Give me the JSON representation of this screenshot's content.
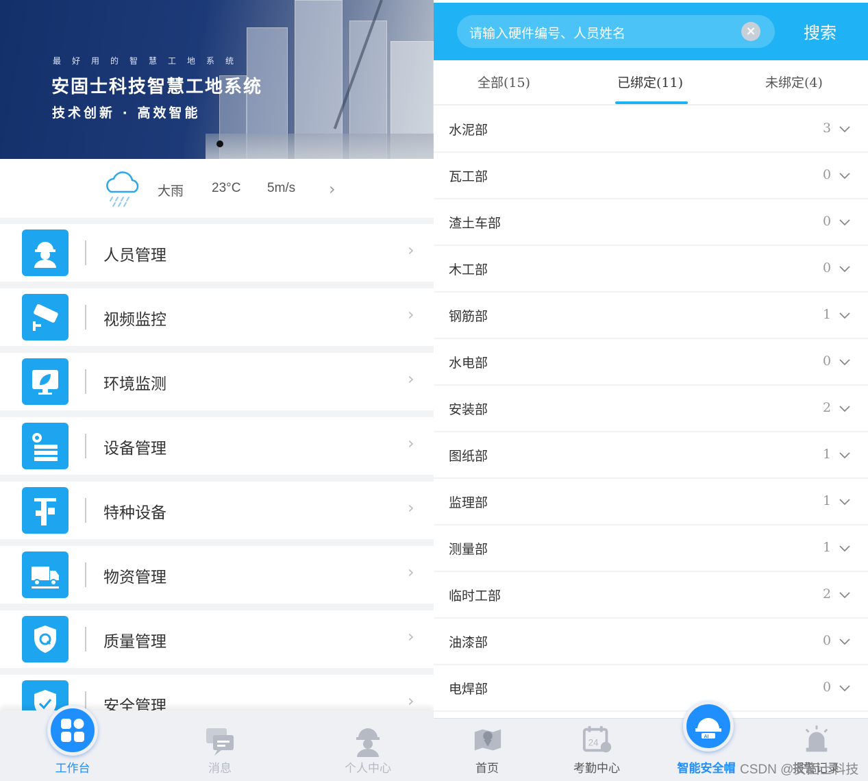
{
  "left": {
    "banner": {
      "tagline": "最好用的智慧工地系统",
      "title": "安固士科技智慧工地系统",
      "subtitle": "技术创新 · 高效智能"
    },
    "weather": {
      "icon": "rain-cloud-icon",
      "condition": "大雨",
      "temperature": "23°C",
      "wind": "5m/s"
    },
    "menu": [
      {
        "label": "人员管理",
        "icon": "worker-icon"
      },
      {
        "label": "视频监控",
        "icon": "camera-icon"
      },
      {
        "label": "环境监测",
        "icon": "monitor-leaf-icon"
      },
      {
        "label": "设备管理",
        "icon": "gear-server-icon"
      },
      {
        "label": "特种设备",
        "icon": "tower-crane-icon"
      },
      {
        "label": "物资管理",
        "icon": "truck-icon"
      },
      {
        "label": "质量管理",
        "icon": "quality-shield-icon"
      },
      {
        "label": "安全管理",
        "icon": "safety-shield-icon"
      }
    ],
    "tabbar": [
      {
        "label": "工作台",
        "icon": "dashboard-icon",
        "active": true
      },
      {
        "label": "消息",
        "icon": "message-icon",
        "active": false
      },
      {
        "label": "个人中心",
        "icon": "user-helmet-icon",
        "active": false
      }
    ]
  },
  "right": {
    "search": {
      "placeholder": "请输入硬件编号、人员姓名",
      "button": "搜索"
    },
    "tabs": [
      {
        "label": "全部(15)",
        "active": false
      },
      {
        "label": "已绑定(11)",
        "active": true
      },
      {
        "label": "未绑定(4)",
        "active": false
      }
    ],
    "departments": [
      {
        "name": "水泥部",
        "count": "3"
      },
      {
        "name": "瓦工部",
        "count": "0"
      },
      {
        "name": "渣土车部",
        "count": "0"
      },
      {
        "name": "木工部",
        "count": "0"
      },
      {
        "name": "钢筋部",
        "count": "1"
      },
      {
        "name": "水电部",
        "count": "0"
      },
      {
        "name": "安装部",
        "count": "2"
      },
      {
        "name": "图纸部",
        "count": "1"
      },
      {
        "name": "监理部",
        "count": "1"
      },
      {
        "name": "测量部",
        "count": "1"
      },
      {
        "name": "临时工部",
        "count": "2"
      },
      {
        "name": "油漆部",
        "count": "0"
      },
      {
        "name": "电焊部",
        "count": "0"
      }
    ],
    "tabbar": [
      {
        "label": "首页",
        "icon": "map-icon",
        "active": false
      },
      {
        "label": "考勤中心",
        "icon": "calendar-icon",
        "active": false
      },
      {
        "label": "智能安全帽",
        "icon": "ai-helmet-icon",
        "active": true
      },
      {
        "label": "报警记录",
        "icon": "alarm-icon",
        "active": false
      }
    ],
    "watermark": "CSDN @安固士科技"
  },
  "colors": {
    "primary": "#1fb2f4",
    "accent": "#1f8fff",
    "icon_bg": "#1ea5ef"
  }
}
